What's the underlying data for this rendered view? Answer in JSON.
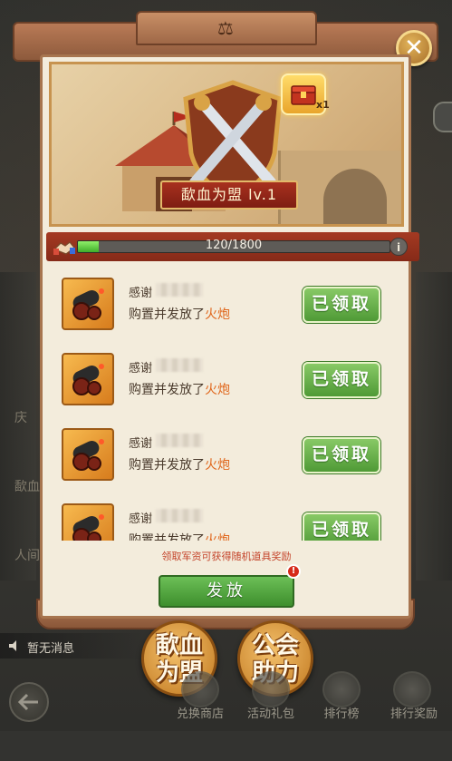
{
  "banner": {
    "level_label": "歃血为盟 lv.1",
    "gift_count": "x1"
  },
  "progress": {
    "current": 120,
    "max": 1800,
    "text": "120/1800",
    "info_label": "i"
  },
  "rows": [
    {
      "thanks": "感谢",
      "desc_prefix": "购置并发放了",
      "item": "火炮",
      "button": "已领取"
    },
    {
      "thanks": "感谢",
      "desc_prefix": "购置并发放了",
      "item": "火炮",
      "button": "已领取"
    },
    {
      "thanks": "感谢",
      "desc_prefix": "购置并发放了",
      "item": "火炮",
      "button": "已领取"
    },
    {
      "thanks": "感谢",
      "desc_prefix": "购置并发放了",
      "item": "火炮",
      "button": "已领取"
    }
  ],
  "hint": "领取军资可获得随机道具奖励",
  "send_button": "发放",
  "send_badge": "!",
  "close_label": "✕",
  "background": {
    "left_labels": [
      "庆",
      "歃血",
      "人间"
    ]
  },
  "message_bar": {
    "text": "暂无消息"
  },
  "feature_badges": [
    {
      "line1": "歃血",
      "line2": "为盟"
    },
    {
      "line1": "公会",
      "line2": "助力"
    }
  ],
  "bottom_nav": [
    "兑换商店",
    "活动礼包",
    "排行榜",
    "排行奖励"
  ],
  "colors": {
    "panel": "#f3ecdc",
    "accent_red": "#a43a22",
    "claim_green": "#4f9a36",
    "item_orange": "#e0661b",
    "progress_green": "#3fae2a"
  }
}
